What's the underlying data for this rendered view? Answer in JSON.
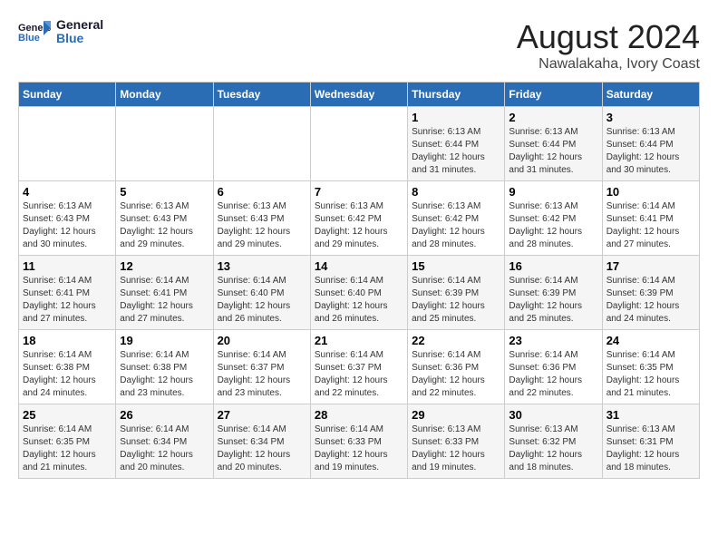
{
  "header": {
    "logo_line1": "General",
    "logo_line2": "Blue",
    "month": "August 2024",
    "location": "Nawalakaha, Ivory Coast"
  },
  "weekdays": [
    "Sunday",
    "Monday",
    "Tuesday",
    "Wednesday",
    "Thursday",
    "Friday",
    "Saturday"
  ],
  "weeks": [
    [
      {
        "day": "",
        "info": ""
      },
      {
        "day": "",
        "info": ""
      },
      {
        "day": "",
        "info": ""
      },
      {
        "day": "",
        "info": ""
      },
      {
        "day": "1",
        "info": "Sunrise: 6:13 AM\nSunset: 6:44 PM\nDaylight: 12 hours and 31 minutes."
      },
      {
        "day": "2",
        "info": "Sunrise: 6:13 AM\nSunset: 6:44 PM\nDaylight: 12 hours and 31 minutes."
      },
      {
        "day": "3",
        "info": "Sunrise: 6:13 AM\nSunset: 6:44 PM\nDaylight: 12 hours and 30 minutes."
      }
    ],
    [
      {
        "day": "4",
        "info": "Sunrise: 6:13 AM\nSunset: 6:43 PM\nDaylight: 12 hours and 30 minutes."
      },
      {
        "day": "5",
        "info": "Sunrise: 6:13 AM\nSunset: 6:43 PM\nDaylight: 12 hours and 29 minutes."
      },
      {
        "day": "6",
        "info": "Sunrise: 6:13 AM\nSunset: 6:43 PM\nDaylight: 12 hours and 29 minutes."
      },
      {
        "day": "7",
        "info": "Sunrise: 6:13 AM\nSunset: 6:42 PM\nDaylight: 12 hours and 29 minutes."
      },
      {
        "day": "8",
        "info": "Sunrise: 6:13 AM\nSunset: 6:42 PM\nDaylight: 12 hours and 28 minutes."
      },
      {
        "day": "9",
        "info": "Sunrise: 6:13 AM\nSunset: 6:42 PM\nDaylight: 12 hours and 28 minutes."
      },
      {
        "day": "10",
        "info": "Sunrise: 6:14 AM\nSunset: 6:41 PM\nDaylight: 12 hours and 27 minutes."
      }
    ],
    [
      {
        "day": "11",
        "info": "Sunrise: 6:14 AM\nSunset: 6:41 PM\nDaylight: 12 hours and 27 minutes."
      },
      {
        "day": "12",
        "info": "Sunrise: 6:14 AM\nSunset: 6:41 PM\nDaylight: 12 hours and 27 minutes."
      },
      {
        "day": "13",
        "info": "Sunrise: 6:14 AM\nSunset: 6:40 PM\nDaylight: 12 hours and 26 minutes."
      },
      {
        "day": "14",
        "info": "Sunrise: 6:14 AM\nSunset: 6:40 PM\nDaylight: 12 hours and 26 minutes."
      },
      {
        "day": "15",
        "info": "Sunrise: 6:14 AM\nSunset: 6:39 PM\nDaylight: 12 hours and 25 minutes."
      },
      {
        "day": "16",
        "info": "Sunrise: 6:14 AM\nSunset: 6:39 PM\nDaylight: 12 hours and 25 minutes."
      },
      {
        "day": "17",
        "info": "Sunrise: 6:14 AM\nSunset: 6:39 PM\nDaylight: 12 hours and 24 minutes."
      }
    ],
    [
      {
        "day": "18",
        "info": "Sunrise: 6:14 AM\nSunset: 6:38 PM\nDaylight: 12 hours and 24 minutes."
      },
      {
        "day": "19",
        "info": "Sunrise: 6:14 AM\nSunset: 6:38 PM\nDaylight: 12 hours and 23 minutes."
      },
      {
        "day": "20",
        "info": "Sunrise: 6:14 AM\nSunset: 6:37 PM\nDaylight: 12 hours and 23 minutes."
      },
      {
        "day": "21",
        "info": "Sunrise: 6:14 AM\nSunset: 6:37 PM\nDaylight: 12 hours and 22 minutes."
      },
      {
        "day": "22",
        "info": "Sunrise: 6:14 AM\nSunset: 6:36 PM\nDaylight: 12 hours and 22 minutes."
      },
      {
        "day": "23",
        "info": "Sunrise: 6:14 AM\nSunset: 6:36 PM\nDaylight: 12 hours and 22 minutes."
      },
      {
        "day": "24",
        "info": "Sunrise: 6:14 AM\nSunset: 6:35 PM\nDaylight: 12 hours and 21 minutes."
      }
    ],
    [
      {
        "day": "25",
        "info": "Sunrise: 6:14 AM\nSunset: 6:35 PM\nDaylight: 12 hours and 21 minutes."
      },
      {
        "day": "26",
        "info": "Sunrise: 6:14 AM\nSunset: 6:34 PM\nDaylight: 12 hours and 20 minutes."
      },
      {
        "day": "27",
        "info": "Sunrise: 6:14 AM\nSunset: 6:34 PM\nDaylight: 12 hours and 20 minutes."
      },
      {
        "day": "28",
        "info": "Sunrise: 6:14 AM\nSunset: 6:33 PM\nDaylight: 12 hours and 19 minutes."
      },
      {
        "day": "29",
        "info": "Sunrise: 6:13 AM\nSunset: 6:33 PM\nDaylight: 12 hours and 19 minutes."
      },
      {
        "day": "30",
        "info": "Sunrise: 6:13 AM\nSunset: 6:32 PM\nDaylight: 12 hours and 18 minutes."
      },
      {
        "day": "31",
        "info": "Sunrise: 6:13 AM\nSunset: 6:31 PM\nDaylight: 12 hours and 18 minutes."
      }
    ]
  ]
}
